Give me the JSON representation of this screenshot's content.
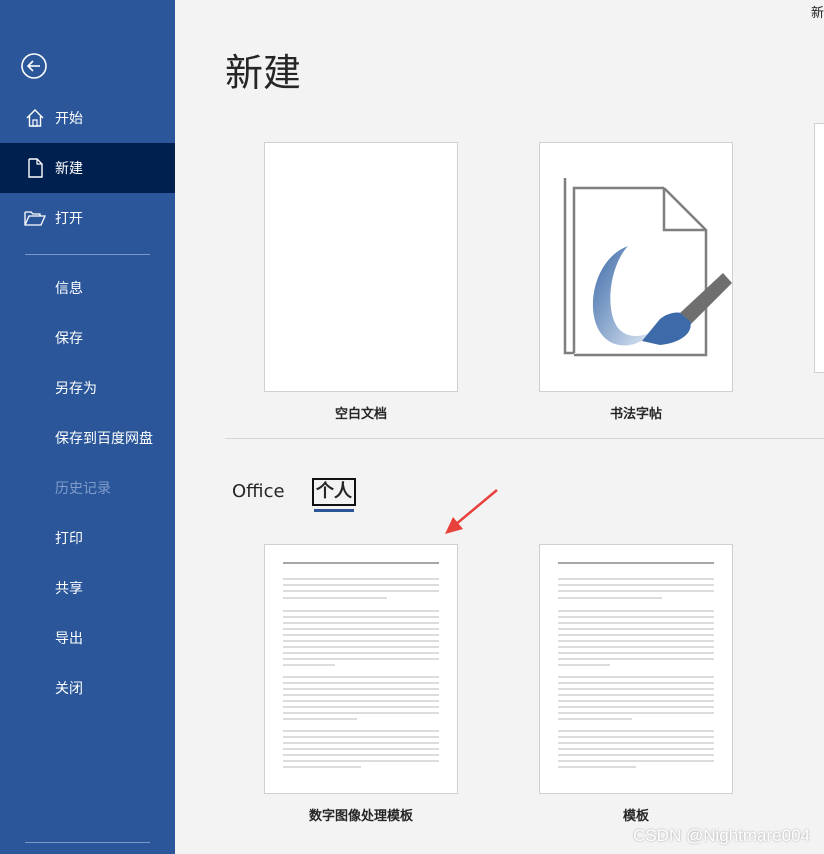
{
  "sidebar": {
    "items": [
      {
        "label": "开始",
        "icon": "home-icon"
      },
      {
        "label": "新建",
        "icon": "new-document-icon"
      },
      {
        "label": "打开",
        "icon": "folder-open-icon"
      },
      {
        "label": "信息"
      },
      {
        "label": "保存"
      },
      {
        "label": "另存为"
      },
      {
        "label": "保存到百度网盘"
      },
      {
        "label": "历史记录"
      },
      {
        "label": "打印"
      },
      {
        "label": "共享"
      },
      {
        "label": "导出"
      },
      {
        "label": "关闭"
      }
    ]
  },
  "main": {
    "corner_text": "新",
    "title": "新建",
    "featured_templates": [
      {
        "label": "空白文档"
      },
      {
        "label": "书法字帖"
      }
    ],
    "tabs": [
      {
        "label": "Office"
      },
      {
        "label": "个人"
      }
    ],
    "personal_templates": [
      {
        "label": "数字图像处理模板"
      },
      {
        "label": "模板"
      }
    ]
  },
  "watermark": "CSDN @Nightmare004",
  "colors": {
    "sidebar_bg": "#2b579a",
    "sidebar_active": "#002050",
    "annotation_arrow": "#e8413c"
  }
}
